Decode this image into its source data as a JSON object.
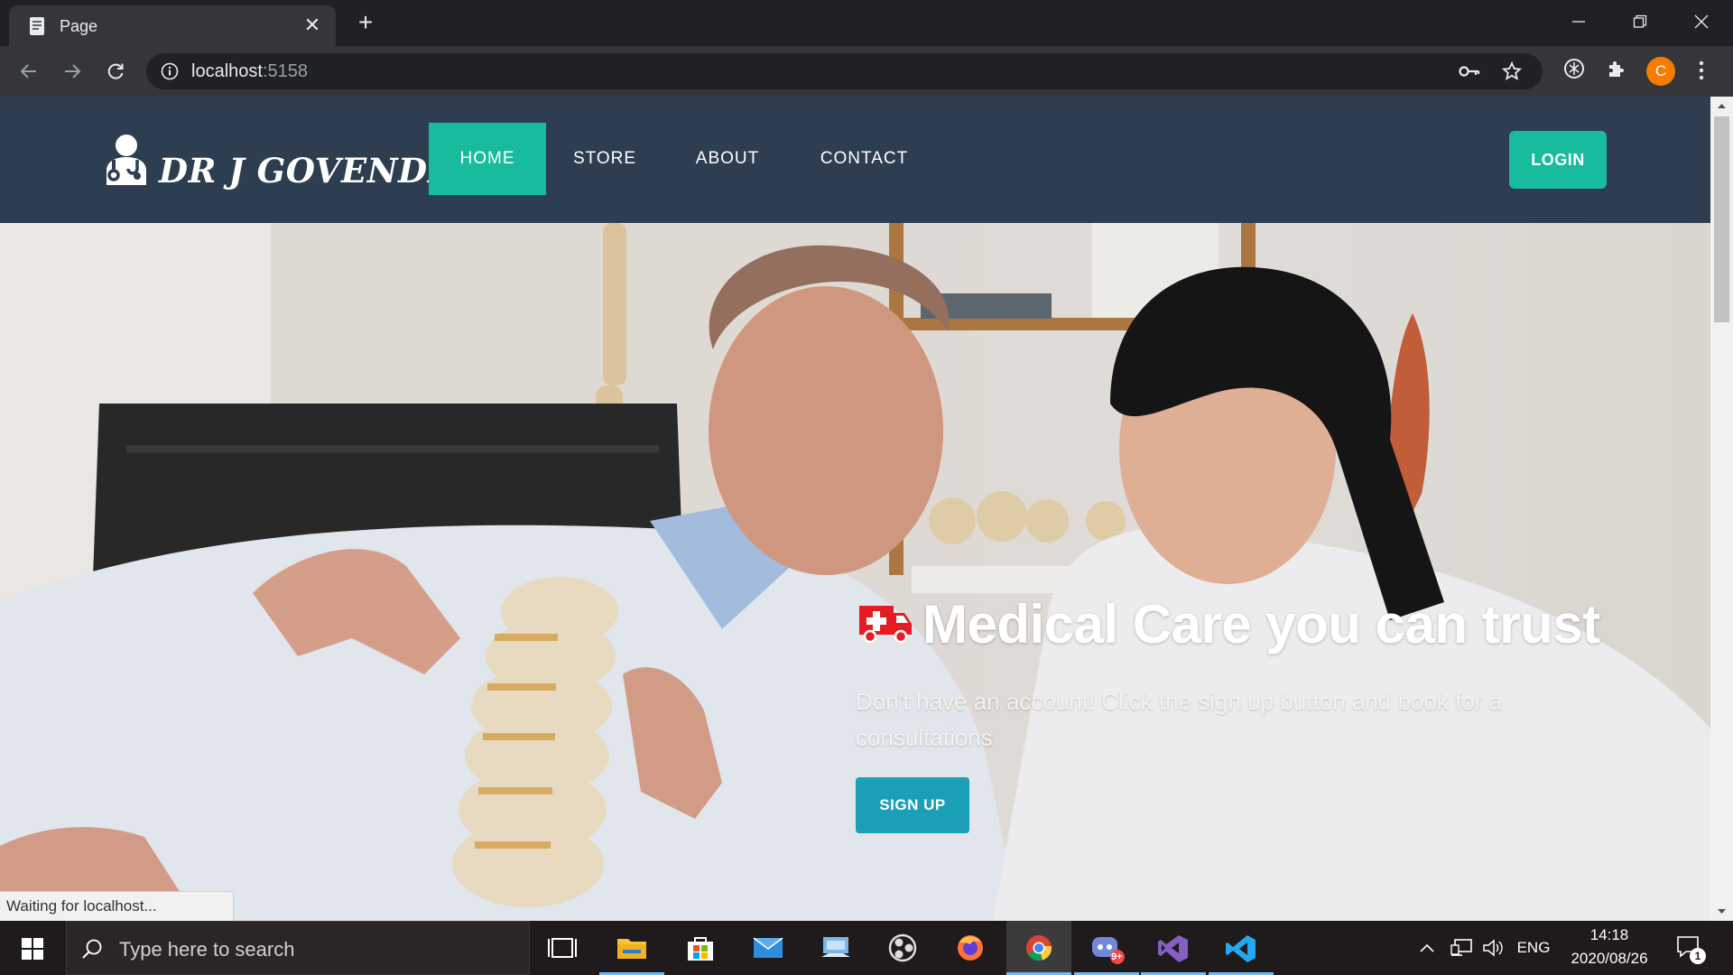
{
  "browser": {
    "tab_title": "Page",
    "url_host": "localhost",
    "url_port": ":5158",
    "profile_initial": "C",
    "status_text": "Waiting for localhost..."
  },
  "site": {
    "brand_name": "DR J GOVENDER",
    "nav_items": [
      {
        "label": "HOME",
        "active": true
      },
      {
        "label": "STORE",
        "active": false
      },
      {
        "label": "ABOUT",
        "active": false
      },
      {
        "label": "CONTACT",
        "active": false
      }
    ],
    "login_label": "LOGIN",
    "colors": {
      "navbar_bg": "#2c3e50",
      "accent_green": "#18bc9c",
      "signup_teal": "#1a9fb6",
      "ambulance_red": "#e51c23"
    }
  },
  "hero": {
    "title": "Medical Care you can trust",
    "subtitle": "Don't have an account! Click the sign up button and book for a consultations",
    "signup_label": "SIGN UP",
    "title_icon": "ambulance-icon"
  },
  "taskbar": {
    "search_placeholder": "Type here to search",
    "language": "ENG",
    "time": "14:18",
    "date": "2020/08/26",
    "notification_count": "1",
    "discord_badge": "9+"
  }
}
